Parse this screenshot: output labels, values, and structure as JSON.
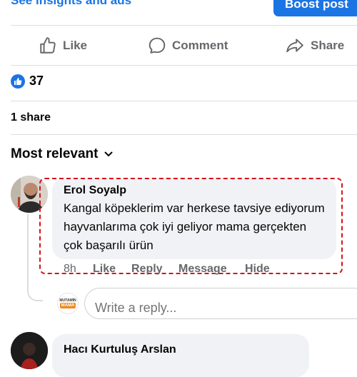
{
  "top": {
    "insights_link": "See insights and ads",
    "boost_button": "Boost post"
  },
  "actions": {
    "like": "Like",
    "comment": "Comment",
    "share": "Share"
  },
  "reactions": {
    "count": "37",
    "shares": "1 share"
  },
  "sort": {
    "label": "Most relevant"
  },
  "comments": [
    {
      "author": "Erol Soyalp",
      "text": "Kangal köpeklerim var herkese tavsiye ediyorum hayvanlarıma çok iyi geliyor mama gerçekten çok başarılı ürün",
      "time": "8h",
      "like": "Like",
      "reply": "Reply",
      "message": "Message",
      "hide": "Hide"
    },
    {
      "author": "Hacı Kurtuluş Arslan"
    }
  ],
  "reply_box": {
    "placeholder": "Write a reply...",
    "avatar_text_top": "MUTAMİN",
    "avatar_text_bottom": "MAMA"
  },
  "colors": {
    "accent": "#1b74e4",
    "highlight": "#d3131c",
    "bubble": "#f0f2f5",
    "secondary_text": "#65676b"
  }
}
